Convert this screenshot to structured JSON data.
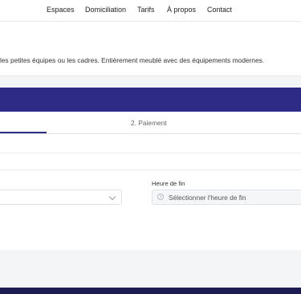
{
  "nav": {
    "items": [
      "Espaces",
      "Domiciliation",
      "Tarifs",
      "À propos",
      "Contact"
    ]
  },
  "hero": {
    "description": "les petites équipes ou les cadres. Entièrement meublé avec des équipements modernes."
  },
  "booking": {
    "tab_payment": "2. Paiement",
    "end_time_label": "Heure de fin",
    "end_time_placeholder": "Sélectionner l'heure de fin"
  },
  "colors": {
    "accent": "#2d2b85",
    "footer": "#1d1c52"
  },
  "icons": [
    "chevron-down-icon",
    "clock-icon"
  ]
}
